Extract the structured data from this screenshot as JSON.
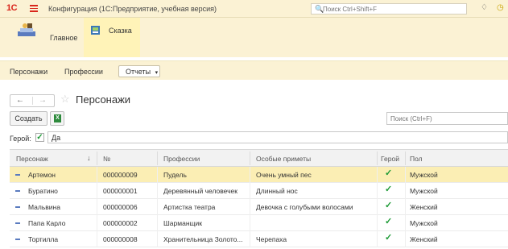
{
  "window": {
    "logo": "1С",
    "title": "Конфигурация  (1С:Предприятие, учебная версия)",
    "search_placeholder": "Поиск Ctrl+Shift+F"
  },
  "sections": [
    {
      "label": "Главное"
    },
    {
      "label": "Сказка"
    }
  ],
  "nav": {
    "items": [
      "Персонажи",
      "Профессии"
    ],
    "reports_label": "Отчеты"
  },
  "form": {
    "title": "Персонажи",
    "create_label": "Создать",
    "search_placeholder": "Поиск (Ctrl+F)",
    "filter_label": "Герой:",
    "filter_checked": true,
    "filter_value": "Да"
  },
  "table": {
    "columns": [
      "Персонаж",
      "№",
      "Профессии",
      "Особые приметы",
      "Герой",
      "Пол"
    ],
    "rows": [
      {
        "name": "Артемон",
        "num": "000000009",
        "profession": "Пудель",
        "marks": "Очень умный пес",
        "hero": true,
        "gender": "Мужской",
        "selected": true
      },
      {
        "name": "Буратино",
        "num": "000000001",
        "profession": "Деревянный человечек",
        "marks": "Длинный нос",
        "hero": true,
        "gender": "Мужской",
        "selected": false
      },
      {
        "name": "Мальвина",
        "num": "000000006",
        "profession": "Артистка театра",
        "marks": "Девочка с голубыми волосами",
        "hero": true,
        "gender": "Женский",
        "selected": false
      },
      {
        "name": "Папа Карло",
        "num": "000000002",
        "profession": "Шарманщик",
        "marks": "",
        "hero": true,
        "gender": "Мужской",
        "selected": false
      },
      {
        "name": "Тортилла",
        "num": "000000008",
        "profession": "Хранительница Золото...",
        "marks": "Черепаха",
        "hero": true,
        "gender": "Женский",
        "selected": false
      }
    ]
  },
  "colors": {
    "accent": "#d9261c",
    "panel_bg": "#fbf2d4",
    "selected_row": "#fbeeb4",
    "check": "#1c9a35"
  }
}
